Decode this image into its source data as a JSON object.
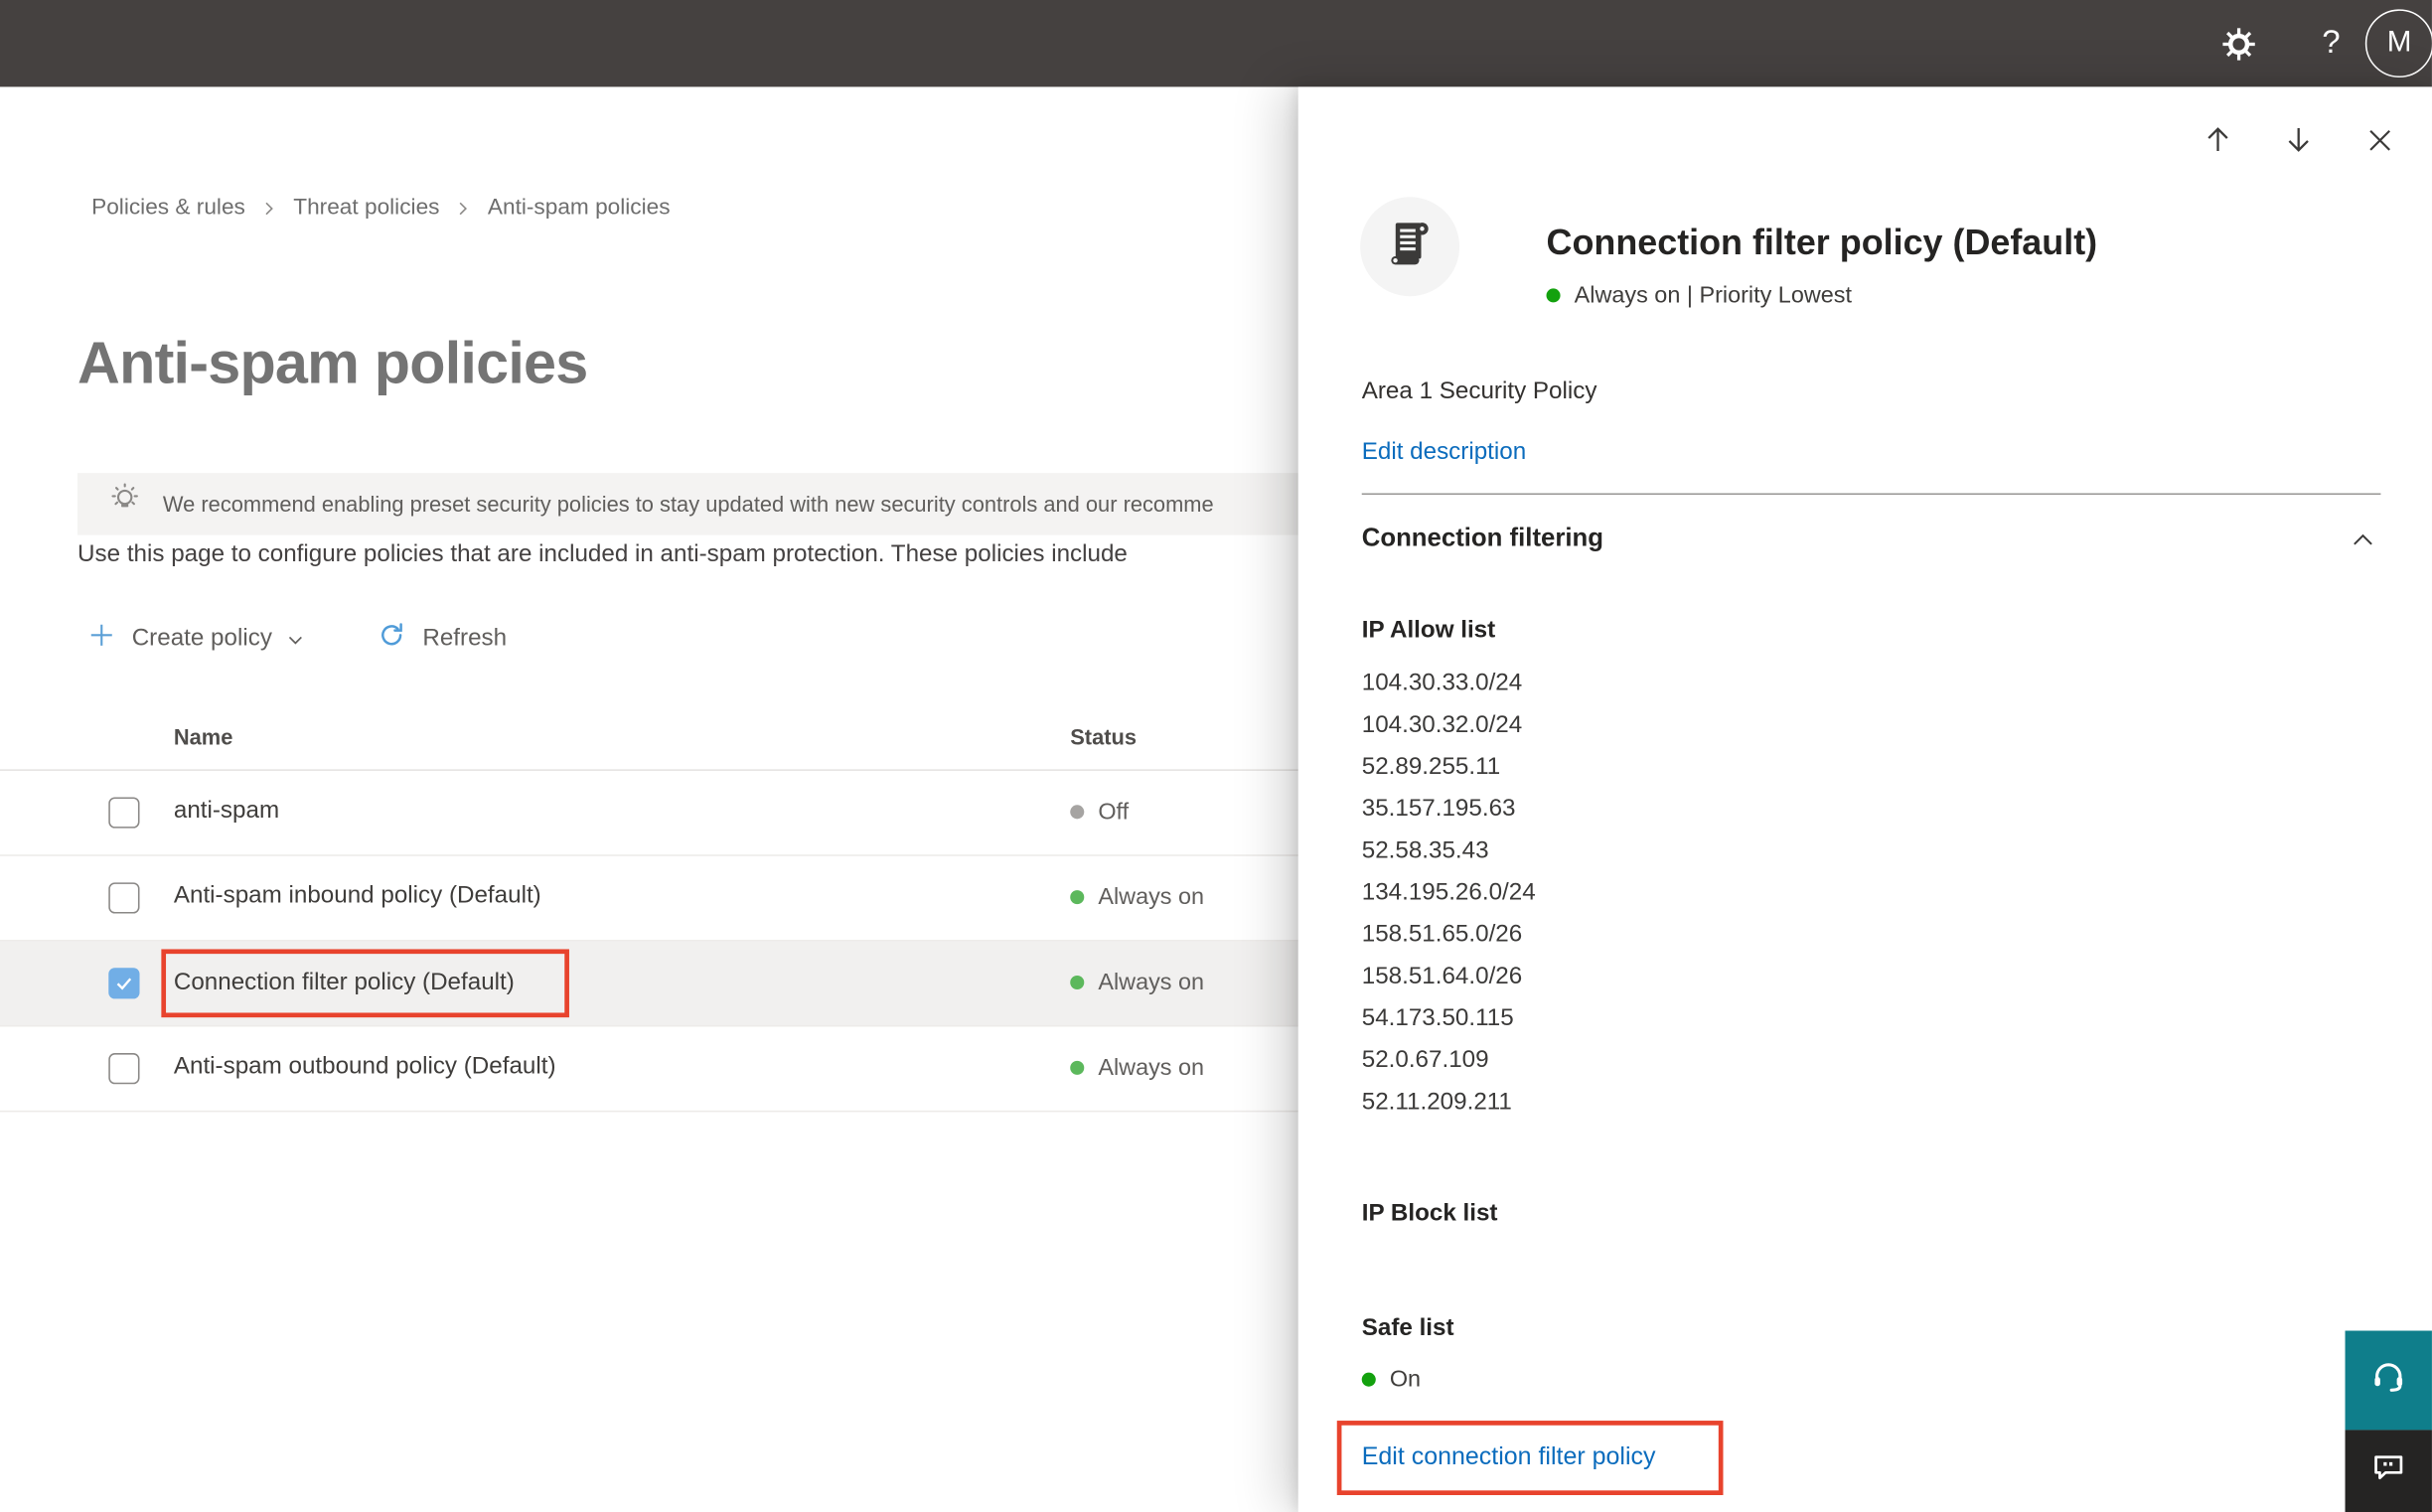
{
  "topbar": {
    "avatar_initial": "M",
    "help_glyph": "?",
    "icons": [
      "settings",
      "help",
      "account"
    ]
  },
  "breadcrumb": {
    "items": [
      "Policies & rules",
      "Threat policies",
      "Anti-spam policies"
    ]
  },
  "page": {
    "title": "Anti-spam policies",
    "banner_text": "We recommend enabling preset security policies to stay updated with new security controls and our recomme",
    "intro_text": "Use this page to configure policies that are included in anti-spam protection. These policies include",
    "toolbar": {
      "create_label": "Create policy",
      "refresh_label": "Refresh"
    }
  },
  "table": {
    "columns": {
      "name": "Name",
      "status": "Status"
    },
    "rows": [
      {
        "name": "anti-spam",
        "status": "Off",
        "checked": false,
        "selected": false
      },
      {
        "name": "Anti-spam inbound policy (Default)",
        "status": "Always on",
        "checked": false,
        "selected": false
      },
      {
        "name": "Connection filter policy (Default)",
        "status": "Always on",
        "checked": true,
        "selected": true,
        "annotated": true
      },
      {
        "name": "Anti-spam outbound policy (Default)",
        "status": "Always on",
        "checked": false,
        "selected": false
      }
    ]
  },
  "flyout": {
    "title": "Connection filter policy (Default)",
    "status_line": "Always on | Priority Lowest",
    "description": "Area 1 Security Policy",
    "edit_description_label": "Edit description",
    "section_title": "Connection filtering",
    "nav_icons": [
      "move-up",
      "move-down",
      "close"
    ],
    "ip_allow": {
      "label": "IP Allow list",
      "items": [
        "104.30.33.0/24",
        "104.30.32.0/24",
        "52.89.255.11",
        "35.157.195.63",
        "52.58.35.43",
        "134.195.26.0/24",
        "158.51.65.0/26",
        "158.51.64.0/26",
        "54.173.50.115",
        "52.0.67.109",
        "52.11.209.211"
      ]
    },
    "ip_block": {
      "label": "IP Block list"
    },
    "safe_list": {
      "label": "Safe list",
      "status": "On"
    },
    "edit_link_label": "Edit connection filter policy",
    "annotated": true
  },
  "widgets": {
    "support_icon": "headset",
    "feedback_icon": "chat"
  },
  "colors": {
    "topbar_bg": "#454140",
    "accent_blue_link": "#0b6cbd",
    "toolbar_icon_blue": "#5b9fd6",
    "annotation_red": "#e8432d",
    "flyout_status_green": "#13a10e",
    "table_status_green": "#5cb85c",
    "table_status_gray": "#a6a4a2",
    "selected_row_bg": "#f1f0ef",
    "checkbox_checked_blue": "#71aee6",
    "support_teal": "#0f7e8b",
    "feedback_dark": "#252423"
  }
}
